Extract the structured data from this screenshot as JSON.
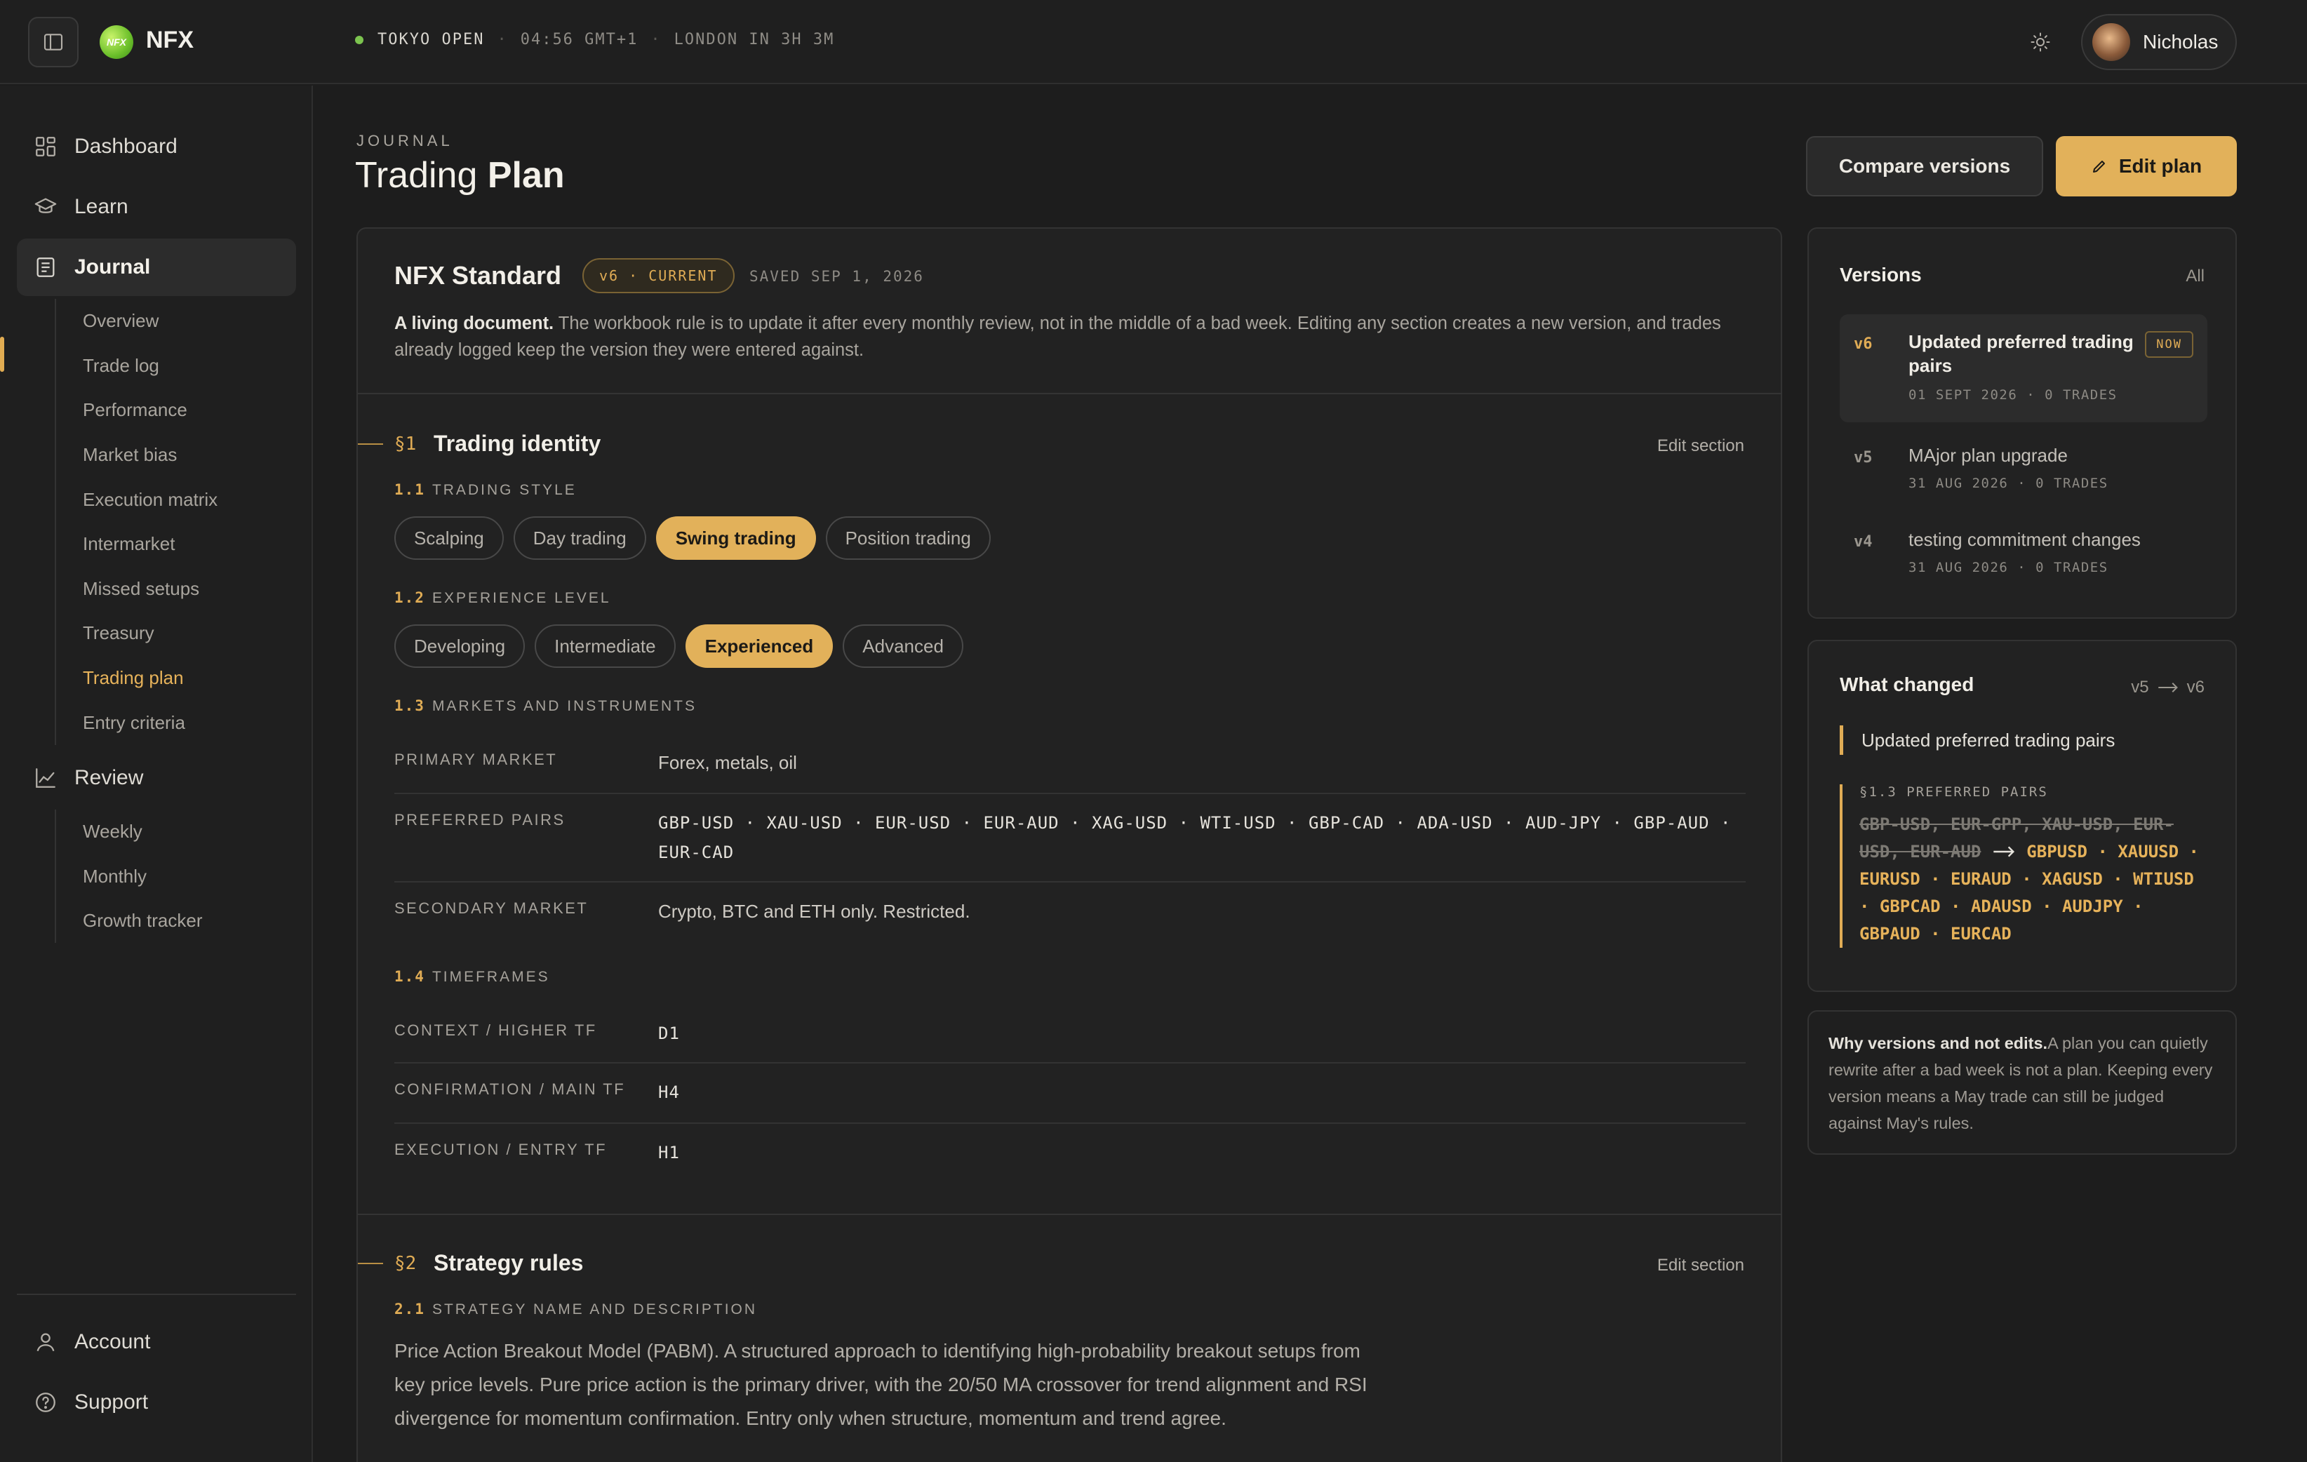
{
  "topbar": {
    "brand": "NFX",
    "logo_text": "NFX",
    "market_session": "TOKYO OPEN",
    "separator": "·",
    "clock": "04:56 GMT+1",
    "next_session": "LONDON IN 3H 3M",
    "user_name": "Nicholas",
    "status_color": "#7cc44f"
  },
  "sidebar": {
    "items": [
      {
        "label": "Dashboard",
        "icon": "dashboard-icon"
      },
      {
        "label": "Learn",
        "icon": "graduation-cap-icon"
      },
      {
        "label": "Journal",
        "icon": "journal-icon",
        "active": true
      },
      {
        "label": "Review",
        "icon": "chart-line-icon"
      }
    ],
    "journal_sub": [
      "Overview",
      "Trade log",
      "Performance",
      "Market bias",
      "Execution matrix",
      "Intermarket",
      "Missed setups",
      "Treasury",
      "Trading plan",
      "Entry criteria"
    ],
    "journal_active": "Trading plan",
    "review_sub": [
      "Weekly",
      "Monthly",
      "Growth tracker"
    ],
    "footer": [
      {
        "label": "Account",
        "icon": "user-icon"
      },
      {
        "label": "Support",
        "icon": "help-circle-icon"
      }
    ]
  },
  "header": {
    "eyebrow": "JOURNAL",
    "title_light": "Trading",
    "title_bold": "Plan",
    "compare_button": "Compare versions",
    "edit_button": "Edit plan"
  },
  "plan": {
    "name": "NFX Standard",
    "version_badge": "v6 · CURRENT",
    "saved": "SAVED SEP 1, 2026",
    "desc_lead": "A living document.",
    "desc_body": " The workbook rule is to update it after every monthly review, not in the middle of a bad week. Editing any section creates a new version, and trades already logged keep the version they were entered against."
  },
  "section1": {
    "num": "§1",
    "title": "Trading identity",
    "edit": "Edit section",
    "style": {
      "num": "1.1",
      "label": "TRADING STYLE",
      "options": [
        "Scalping",
        "Day trading",
        "Swing trading",
        "Position trading"
      ],
      "selected": "Swing trading"
    },
    "experience": {
      "num": "1.2",
      "label": "EXPERIENCE LEVEL",
      "options": [
        "Developing",
        "Intermediate",
        "Experienced",
        "Advanced"
      ],
      "selected": "Experienced"
    },
    "markets": {
      "num": "1.3",
      "label": "MARKETS AND INSTRUMENTS",
      "rows": [
        {
          "label": "PRIMARY MARKET",
          "value": "Forex, metals, oil"
        },
        {
          "label": "PREFERRED PAIRS",
          "value": "GBP-USD · XAU-USD · EUR-USD · EUR-AUD · XAG-USD · WTI-USD · GBP-CAD · ADA-USD · AUD-JPY · GBP-AUD · EUR-CAD"
        },
        {
          "label": "SECONDARY MARKET",
          "value": "Crypto, BTC and ETH only. Restricted."
        }
      ]
    },
    "timeframes": {
      "num": "1.4",
      "label": "TIMEFRAMES",
      "rows": [
        {
          "label": "CONTEXT / HIGHER TF",
          "value": "D1"
        },
        {
          "label": "CONFIRMATION / MAIN TF",
          "value": "H4"
        },
        {
          "label": "EXECUTION / ENTRY TF",
          "value": "H1"
        }
      ]
    }
  },
  "section2": {
    "num": "§2",
    "title": "Strategy rules",
    "edit": "Edit section",
    "sub_num": "2.1",
    "sub_label": "STRATEGY NAME AND DESCRIPTION",
    "description": "Price Action Breakout Model (PABM). A structured approach to identifying high-probability breakout setups from key price levels. Pure price action is the primary driver, with the 20/50 MA crossover for trend alignment and RSI divergence for momentum confirmation. Entry only when structure, momentum and trend agree."
  },
  "versions": {
    "title": "Versions",
    "all_link": "All",
    "items": [
      {
        "v": "v6",
        "title": "Updated preferred trading pairs",
        "meta": "01 SEPT 2026 · 0 TRADES",
        "badge": "NOW",
        "current": true
      },
      {
        "v": "v5",
        "title": "MAjor plan upgrade",
        "meta": "31 AUG 2026 · 0 TRADES"
      },
      {
        "v": "v4",
        "title": "testing commitment changes",
        "meta": "31 AUG 2026 · 0 TRADES"
      }
    ]
  },
  "changes": {
    "title": "What changed",
    "from": "v5",
    "to": "v6",
    "summary": "Updated preferred trading pairs",
    "field_label": "§1.3 PREFERRED PAIRS",
    "old_value": "GBP-USD, EUR-GPP, XAU-USD, EUR-USD, EUR-AUD",
    "new_value": "GBPUSD · XAUUSD · EURUSD · EURAUD · XAGUSD · WTIUSD · GBPCAD · ADAUSD · AUDJPY · GBPAUD · EURCAD"
  },
  "note": {
    "lead": "Why versions and not edits.",
    "body": "A plan you can quietly rewrite after a bad week is not a plan. Keeping every version means a May trade can still be judged against May's rules."
  },
  "colors": {
    "accent": "#e2b15a",
    "background": "#1d1d1d",
    "panel": "#222222"
  }
}
